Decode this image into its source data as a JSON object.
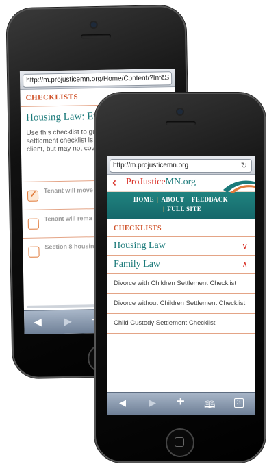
{
  "back_phone": {
    "url": "http://m.projusticemn.org/Home/Content/?InfoS",
    "section_title": "CHECKLISTS",
    "heading": "Housing Law: Evic Checklist",
    "paragraph": "Use this checklist to gu eviction settlement. R settlement checklist is topics most likely to be client, but may not cov",
    "checklist": [
      {
        "label": "Tenant will move",
        "checked": true
      },
      {
        "label": "Tenant will rema the property",
        "checked": false
      },
      {
        "label": "Section 8 housin",
        "checked": false
      }
    ]
  },
  "front_phone": {
    "url": "http://m.projusticemn.org",
    "logo_pro": "Pro",
    "logo_justice": "Justice",
    "logo_mn": "MN.org",
    "nav": {
      "home": "HOME",
      "about": "ABOUT",
      "feedback": "FEEDBACK",
      "full_site": "FULL SITE"
    },
    "section_title": "CHECKLISTS",
    "accordions": [
      {
        "label": "Housing Law",
        "expanded": false
      },
      {
        "label": "Family Law",
        "expanded": true
      }
    ],
    "family_items": [
      "Divorce with Children Settlement Checklist",
      "Divorce without Children Settlement Checklist",
      "Child Custody Settlement Checklist"
    ],
    "tabs_count": "3"
  },
  "colors": {
    "accent_orange": "#d0532b",
    "teal": "#1b7a7a",
    "nav_teal": "#15676a",
    "chevron_red": "#d9342b"
  }
}
